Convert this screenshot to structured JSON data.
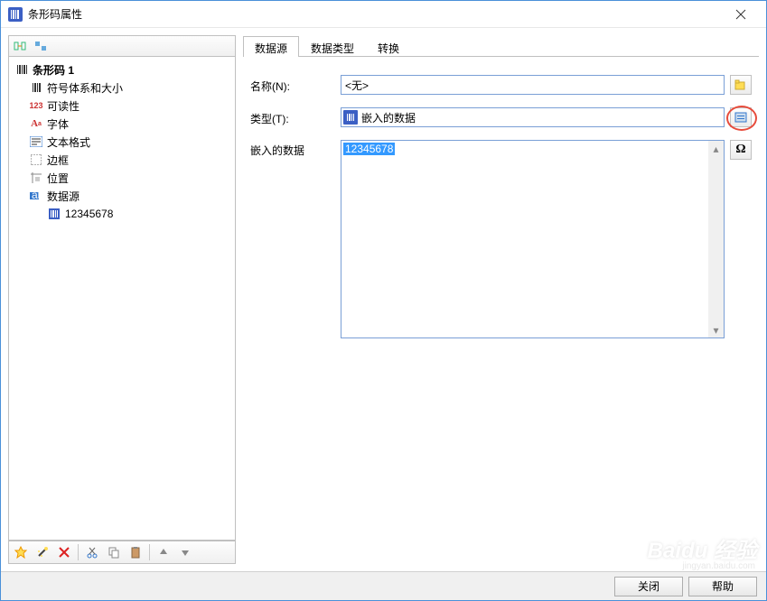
{
  "window": {
    "title": "条形码属性"
  },
  "tree": {
    "root": "条形码 1",
    "items": [
      {
        "label": "符号体系和大小",
        "icon": "barcode"
      },
      {
        "label": "可读性",
        "icon": "num123"
      },
      {
        "label": "字体",
        "icon": "font"
      },
      {
        "label": "文本格式",
        "icon": "textformat"
      },
      {
        "label": "边框",
        "icon": "border"
      },
      {
        "label": "位置",
        "icon": "position"
      },
      {
        "label": "数据源",
        "icon": "datasource"
      }
    ],
    "datasource_child": "12345678"
  },
  "tabs": {
    "t0": "数据源",
    "t1": "数据类型",
    "t2": "转换"
  },
  "form": {
    "name_label": "名称(N):",
    "name_value": "<无>",
    "type_label": "类型(T):",
    "type_value": "嵌入的数据",
    "data_label": "嵌入的数据",
    "data_value": "12345678",
    "omega": "Ω"
  },
  "footer": {
    "close": "关闭",
    "help": "帮助"
  },
  "watermark": {
    "main": "Baidu 经验",
    "sub": "jingyan.baidu.com"
  }
}
